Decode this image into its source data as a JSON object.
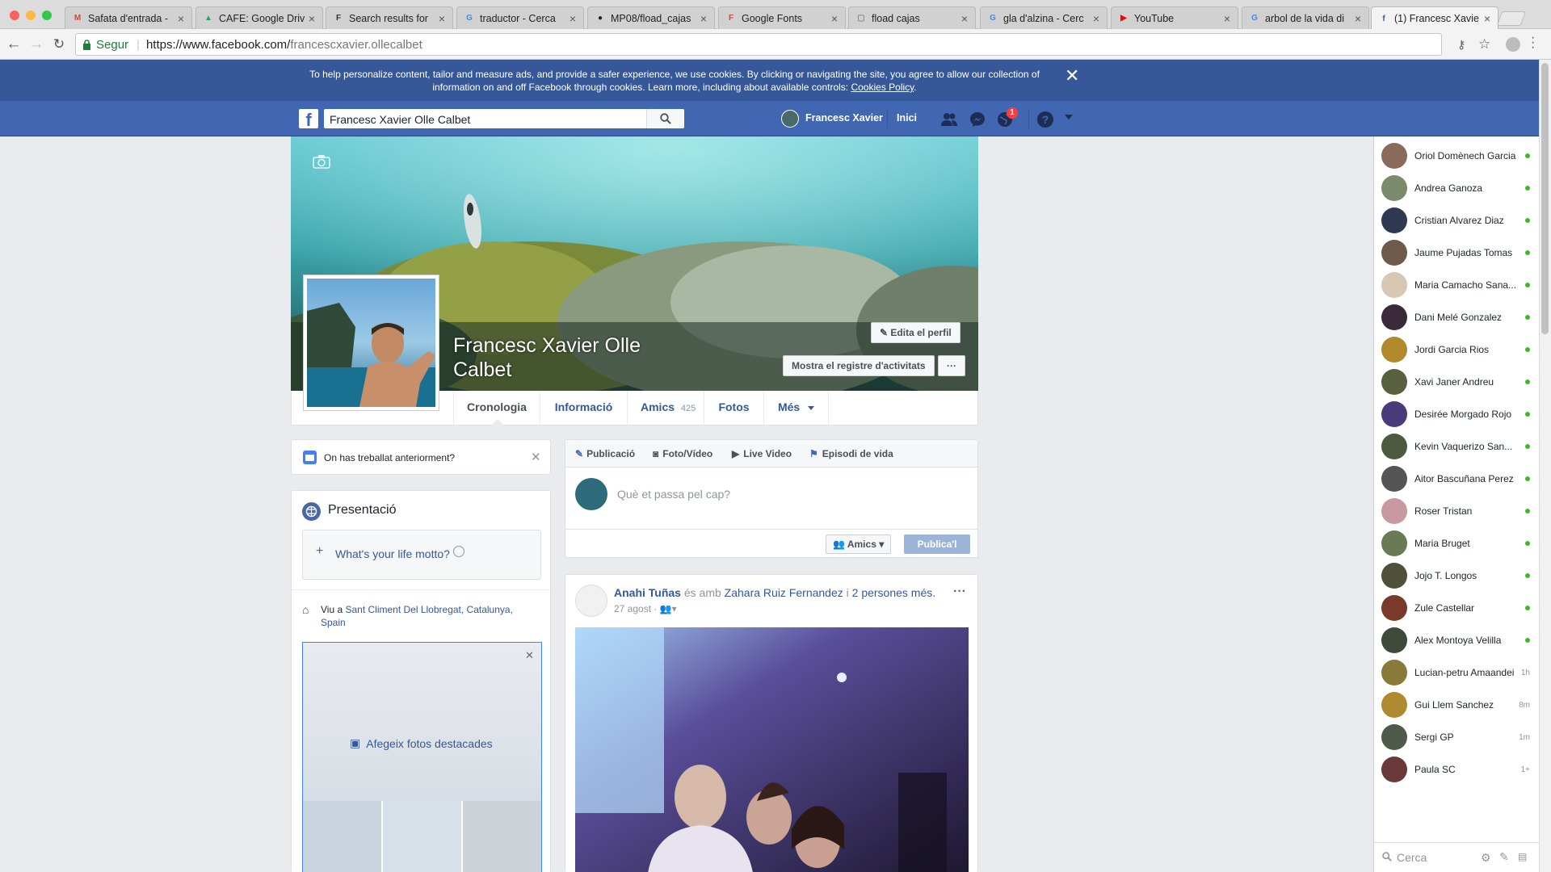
{
  "browser": {
    "tabs": [
      {
        "title": "Safata d'entrada -",
        "fav": "M",
        "fav_color": "#d44638"
      },
      {
        "title": "CAFE: Google Driv",
        "fav": "▲",
        "fav_color": "#1fa463"
      },
      {
        "title": "Search results for",
        "fav": "F",
        "fav_color": "#333333"
      },
      {
        "title": "traductor - Cerca",
        "fav": "G",
        "fav_color": "#4285f4"
      },
      {
        "title": "MP08/fload_cajas",
        "fav": "●",
        "fav_color": "#222222"
      },
      {
        "title": "Google Fonts",
        "fav": "F",
        "fav_color": "#ea4335"
      },
      {
        "title": "fload cajas",
        "fav": "▢",
        "fav_color": "#888888"
      },
      {
        "title": "gla d'alzina - Cerc",
        "fav": "G",
        "fav_color": "#4285f4"
      },
      {
        "title": "YouTube",
        "fav": "▶",
        "fav_color": "#ff0000"
      },
      {
        "title": "arbol de la vida di",
        "fav": "G",
        "fav_color": "#4285f4"
      },
      {
        "title": "(1) Francesc Xavie",
        "fav": "f",
        "fav_color": "#3b5998"
      }
    ],
    "secure_label": "Segur",
    "url_host": "https://www.facebook.com/",
    "url_path": "francescxavier.ollecalbet"
  },
  "cookie": {
    "text": "To help personalize content, tailor and measure ads, and provide a safer experience, we use cookies. By clicking or navigating the site, you agree to allow our collection of information on and off Facebook through cookies. Learn more, including about available controls: ",
    "link": "Cookies Policy",
    "end": "."
  },
  "fbbar": {
    "search_value": "Francesc Xavier Olle Calbet",
    "user_name": "Francesc Xavier",
    "home": "Inici",
    "notif_count": "1"
  },
  "profile": {
    "name": "Francesc Xavier Olle Calbet",
    "edit_profile": "Edita el perfil",
    "activity_log": "Mostra el registre d'activitats",
    "more_dots": "···",
    "tabs": {
      "timeline": "Cronologia",
      "about": "Informació",
      "friends": "Amics",
      "friends_count": "425",
      "photos": "Fotos",
      "more": "Més"
    }
  },
  "left": {
    "work_prompt": "On has treballat anteriorment?",
    "intro_title": "Presentació",
    "motto": "What's your life motto?",
    "lives_prefix": "Viu a ",
    "lives_place": "Sant Climent Del Llobregat, Catalunya, Spain",
    "add_featured": "Afegeix fotos destacades"
  },
  "composer": {
    "tab_post": "Publicació",
    "tab_photo": "Foto/Vídeo",
    "tab_live": "Live Video",
    "tab_event": "Episodi de vida",
    "placeholder": "Què et passa pel cap?",
    "audience": "Amics",
    "publish": "Publica'l"
  },
  "post": {
    "author": "Anahi Tuñas",
    "with_text": " és amb ",
    "tagged": "Zahara Ruiz Fernandez",
    "and_text": " i ",
    "others": "2 persones més.",
    "date": "27 agost",
    "dots": "···"
  },
  "chat": {
    "contacts": [
      {
        "name": "Oriol Domènech Garcia",
        "status": "online",
        "color": "#8a6b5a"
      },
      {
        "name": "Andrea Ganoza",
        "status": "online",
        "color": "#7c8a6c"
      },
      {
        "name": "Cristian Alvarez Diaz",
        "status": "online",
        "color": "#2f3a52"
      },
      {
        "name": "Jaume Pujadas Tomas",
        "status": "online",
        "color": "#6e5a48"
      },
      {
        "name": "Maria Camacho Sana...",
        "status": "online",
        "color": "#d8c7b5"
      },
      {
        "name": "Dani Melé Gonzalez",
        "status": "online",
        "color": "#3a2a3a"
      },
      {
        "name": "Jordi Garcia Rios",
        "status": "online",
        "color": "#b08a2a"
      },
      {
        "name": "Xavi Janer Andreu",
        "status": "online",
        "color": "#59603f"
      },
      {
        "name": "Desirée Morgado Rojo",
        "status": "online",
        "color": "#4a3a7a"
      },
      {
        "name": "Kevin Vaquerizo San...",
        "status": "online",
        "color": "#4d5a40"
      },
      {
        "name": "Aitor Bascuñana Perez",
        "status": "online",
        "color": "#555555"
      },
      {
        "name": "Roser Tristan",
        "status": "online",
        "color": "#c69aa0"
      },
      {
        "name": "Maria Bruget",
        "status": "online",
        "color": "#6a7a55"
      },
      {
        "name": "Jojo T. Longos",
        "status": "online",
        "color": "#4f4f3a"
      },
      {
        "name": "Zule Castellar",
        "status": "online",
        "color": "#7a3a2a"
      },
      {
        "name": "Alex Montoya Velilla",
        "status": "online",
        "color": "#3f4a3a"
      },
      {
        "name": "Lucian-petru Amaandei",
        "status": "1h",
        "color": "#8a7a3a"
      },
      {
        "name": "Gui Llem Sanchez",
        "status": "8m",
        "color": "#b08a30"
      },
      {
        "name": "Sergi GP",
        "status": "1m",
        "color": "#505a4a"
      },
      {
        "name": "Paula SC",
        "status": "1+",
        "color": "#6a3a3a"
      }
    ],
    "search": "Cerca"
  }
}
